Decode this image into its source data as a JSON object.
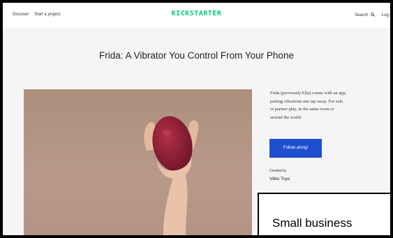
{
  "header": {
    "nav_left": [
      "Discover",
      "Start a project"
    ],
    "logo": "KICKSTARTER",
    "search": "Search",
    "login": "Log in"
  },
  "project": {
    "title": "Frida: A Vibrator You Control From Your Phone",
    "description_lines": [
      "Frida (previously Ella) comes with an app,",
      "putting vibrations one tap away. For solo",
      "or partner play, in the same room or",
      "around the world."
    ],
    "follow_button": "Follow along!",
    "created_by_label": "Created by",
    "creator": "Vibio Toys"
  },
  "overlay": {
    "caption": "Small business"
  },
  "colors": {
    "brand_green": "#05ce78",
    "button_blue": "#1e4fcf",
    "hero_bg": "#b39382",
    "device": "#8e1f35"
  }
}
